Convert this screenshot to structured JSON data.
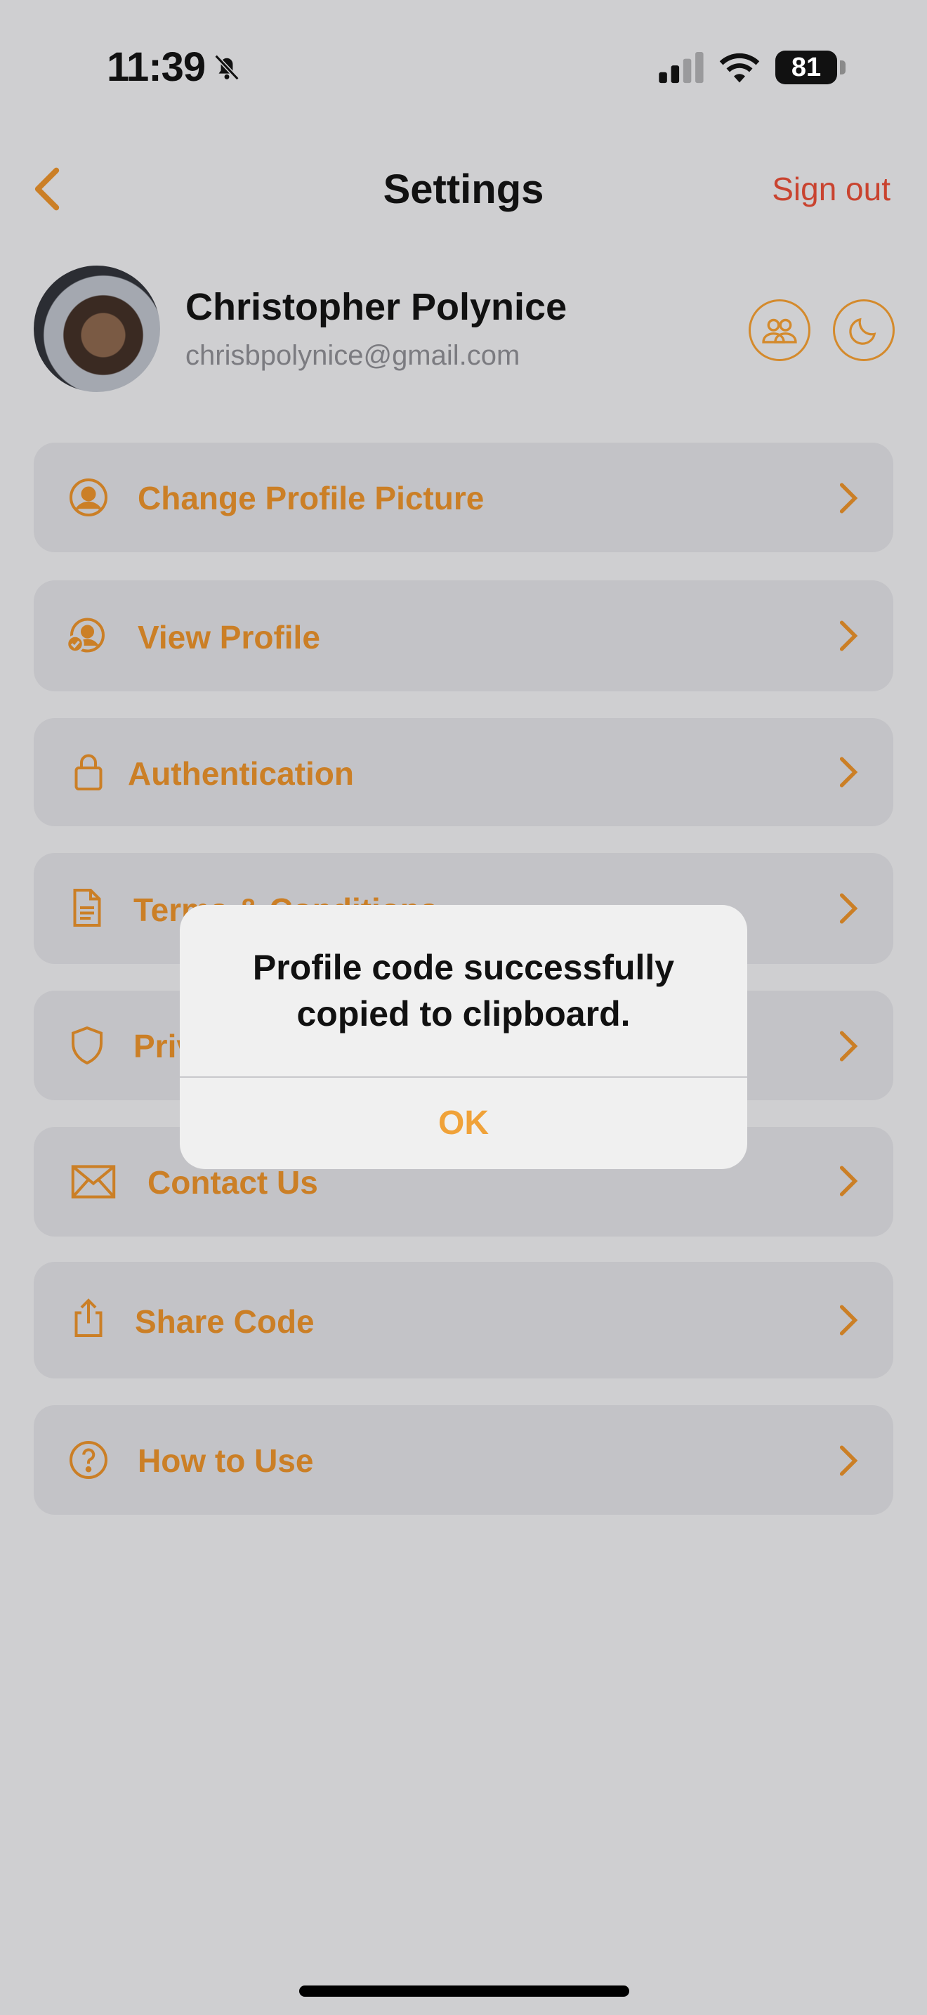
{
  "status_bar": {
    "time": "11:39",
    "battery": "81"
  },
  "header": {
    "title": "Settings",
    "sign_out": "Sign out"
  },
  "profile": {
    "name": "Christopher Polynice",
    "email": "chrisbpolynice@gmail.com"
  },
  "menu": [
    {
      "label": "Change Profile Picture",
      "icon": "person-circle-icon"
    },
    {
      "label": "View Profile",
      "icon": "person-check-icon"
    },
    {
      "label": "Authentication",
      "icon": "lock-icon"
    },
    {
      "label": "Terms & Conditions",
      "icon": "document-icon"
    },
    {
      "label": "Privacy Policy",
      "icon": "shield-icon"
    },
    {
      "label": "Contact Us",
      "icon": "envelope-icon"
    },
    {
      "label": "Share Code",
      "icon": "share-icon"
    },
    {
      "label": "How to Use",
      "icon": "question-circle-icon"
    }
  ],
  "alert": {
    "message": "Profile code successfully copied to clipboard.",
    "ok": "OK"
  },
  "colors": {
    "accent": "#cb7f26",
    "sign_out": "#c9432f",
    "background": "#cfcfd1",
    "card": "#c3c3c7"
  }
}
